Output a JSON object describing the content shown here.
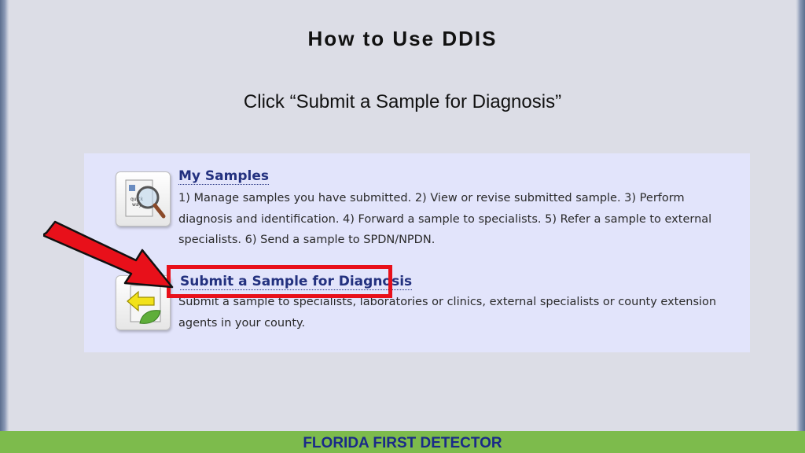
{
  "slide": {
    "title": "How to Use DDIS",
    "subtitle": "Click “Submit a Sample for Diagnosis”"
  },
  "menu": {
    "items": [
      {
        "label": "My Samples",
        "description": "1) Manage samples you have submitted. 2) View or revise submitted sample. 3) Perform diagnosis and identification. 4) Forward a sample to specialists. 5) Refer a sample to external specialists. 6) Send a sample to SPDN/NPDN.",
        "icon": "magnifier-document-icon",
        "icon_text": "quick\nway"
      },
      {
        "label": "Submit a Sample for Diagnosis",
        "description": "Submit a sample to specialists, laboratories or clinics, external specialists or county extension agents in your county.",
        "icon": "leaf-arrow-icon"
      }
    ]
  },
  "annotation": {
    "highlight_color": "#e8101a",
    "arrow_color": "#e8101a"
  },
  "footer": {
    "text": "FLORIDA FIRST DETECTOR",
    "bar_color": "#7dbb4c"
  }
}
